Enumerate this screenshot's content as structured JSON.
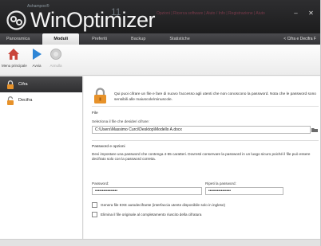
{
  "app": {
    "brand": "Ashampoo®",
    "name": "WinOptimizer",
    "version": "11",
    "top_links": "Opzioni | Ricerca software | Aiuto / Info | Registrazione | Aiuto",
    "window_buttons": [
      "–",
      "✕"
    ]
  },
  "nav": {
    "tabs": [
      "Panoramica",
      "Moduli",
      "Preferiti",
      "Backup",
      "Statistiche"
    ],
    "active": "Moduli",
    "right": "< Cifra e Decifra F"
  },
  "ribbon": {
    "items": [
      {
        "label": "Menu principale",
        "icon": "home-icon"
      },
      {
        "label": "Avvia",
        "icon": "play-icon"
      },
      {
        "label": "Annulla",
        "icon": "cancel-icon"
      }
    ]
  },
  "sidebar": {
    "items": [
      {
        "label": "Cifra",
        "icon": "lock-icon"
      },
      {
        "label": "Decifra",
        "icon": "lock-open-icon"
      }
    ]
  },
  "main": {
    "info": "Qui puoi cifrare un file e fare di nuovo l'accesso agli utenti che non conoscono la password. Nota che le password sono sensibili alle maiuscole/minuscole.",
    "file_section": "File",
    "file_label": "Seleziona il file che desideri cifrare:",
    "file_value": "C:\\Users\\Massimo Curci\\Desktop\\Modello A.docx",
    "pw_section": "Password e opzioni",
    "pw_desc": "Devi impostare una password che contenga 4-55 caratteri. Dovresti conservare la password in un luogo sicuro poiché il file può essere decifrato solo con la password corretta.",
    "pw_label": "Password:",
    "pw_value": "••••••••••••••••",
    "pw2_label": "Ripeti la password:",
    "pw2_value": "••••••••••••••••",
    "opt1": "Genera file EXE autodecifrante (interfaccia utente disponibile solo in inglese)",
    "opt2": "Elimina il file originale al completamento riuscito della cifratura"
  },
  "colors": {
    "titlebar": "#1c1c1d",
    "active_sidebar": "#2e2e30",
    "lock_orange": "#e7922a",
    "play_blue": "#2f86d6",
    "home_red": "#c9453a"
  }
}
